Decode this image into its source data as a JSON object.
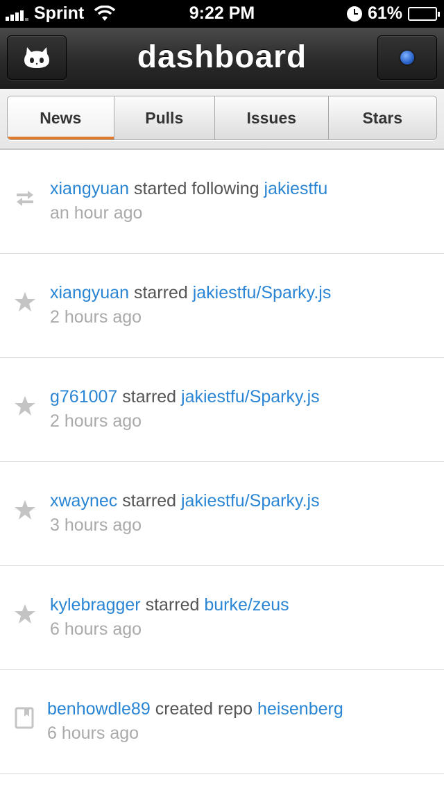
{
  "status_bar": {
    "carrier": "Sprint",
    "time": "9:22 PM",
    "battery": "61%",
    "battery_level": 0.61
  },
  "header": {
    "title": "dashboard"
  },
  "tabs": [
    {
      "label": "News",
      "active": true
    },
    {
      "label": "Pulls",
      "active": false
    },
    {
      "label": "Issues",
      "active": false
    },
    {
      "label": "Stars",
      "active": false
    }
  ],
  "colors": {
    "link": "#2a86d4",
    "active_tab_underline": "#e07a2c",
    "notification_dot": "#2a62c9"
  },
  "feed": [
    {
      "icon": "follow-icon",
      "actor": "xiangyuan",
      "action": "started following",
      "target": "jakiestfu",
      "time": "an hour ago"
    },
    {
      "icon": "star-icon",
      "actor": "xiangyuan",
      "action": "starred",
      "target": "jakiestfu/Sparky.js",
      "time": "2 hours ago"
    },
    {
      "icon": "star-icon",
      "actor": "g761007",
      "action": "starred",
      "target": "jakiestfu/Sparky.js",
      "time": "2 hours ago"
    },
    {
      "icon": "star-icon",
      "actor": "xwaynec",
      "action": "starred",
      "target": "jakiestfu/Sparky.js",
      "time": "3 hours ago"
    },
    {
      "icon": "star-icon",
      "actor": "kylebragger",
      "action": "starred",
      "target": "burke/zeus",
      "time": "6 hours ago"
    },
    {
      "icon": "repo-icon",
      "actor": "benhowdle89",
      "action": "created repo",
      "target": "heisenberg",
      "time": "6 hours ago"
    }
  ]
}
